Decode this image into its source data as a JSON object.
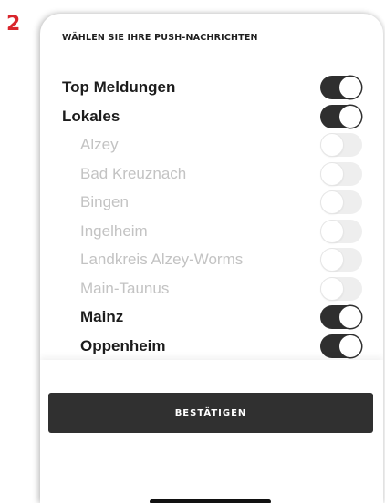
{
  "step_number": "2",
  "screen": {
    "heading": "WÄHLEN SIE IHRE PUSH-NACHRICHTEN",
    "toggles": [
      {
        "label": "Top Meldungen",
        "on": true
      },
      {
        "label": "Lokales",
        "on": true
      },
      {
        "label": "Alzey",
        "on": false
      },
      {
        "label": "Bad Kreuznach",
        "on": false
      },
      {
        "label": "Bingen",
        "on": false
      },
      {
        "label": "Ingelheim",
        "on": false
      },
      {
        "label": "Landkreis Alzey-Worms",
        "on": false
      },
      {
        "label": "Main-Taunus",
        "on": false
      },
      {
        "label": "Mainz",
        "on": true
      },
      {
        "label": "Oppenheim",
        "on": true
      }
    ],
    "confirm_label": "BESTÄTIGEN"
  },
  "colors": {
    "step_number": "#d9252c",
    "switch_on": "#2f2f2f",
    "switch_off": "#eeeeee",
    "button": "#303030"
  }
}
